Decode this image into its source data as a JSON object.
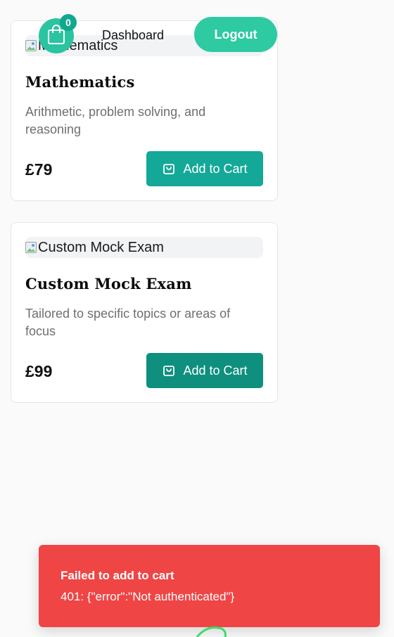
{
  "header": {
    "cart_count": "0",
    "dashboard_label": "Dashboard",
    "logout_label": "Logout"
  },
  "products": [
    {
      "image_alt": "Mathematics",
      "title": "Mathematics",
      "description": "Arithmetic, problem solving, and reasoning",
      "price": "£79",
      "button_label": "Add to Cart"
    },
    {
      "image_alt": "Custom Mock Exam",
      "title": "Custom Mock Exam",
      "description": "Tailored to specific topics or areas of focus",
      "price": "£99",
      "button_label": "Add to Cart"
    }
  ],
  "toast": {
    "title": "Failed to add to cart",
    "message": "401: {\"error\":\"Not authenticated\"}"
  },
  "colors": {
    "accent": "#14a898",
    "accent_light": "#2ecaa1",
    "error": "#ef4545",
    "background": "#fafafa"
  },
  "icons": {
    "cart": "shopping-bag-icon",
    "broken_image": "broken-image-icon"
  }
}
